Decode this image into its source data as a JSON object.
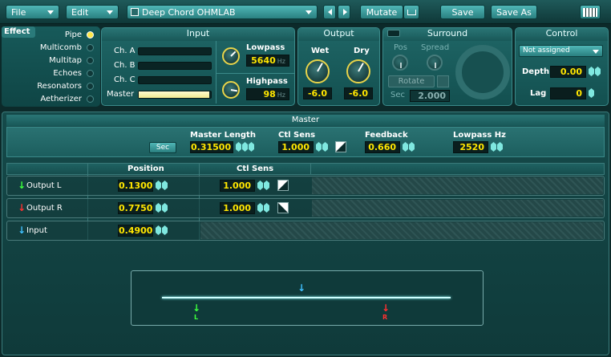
{
  "toolbar": {
    "file": "File",
    "edit": "Edit",
    "preset_name": "Deep Chord OHMLAB",
    "mutate": "Mutate",
    "save": "Save",
    "save_as": "Save As"
  },
  "effect": {
    "tab": "Effect",
    "items": [
      {
        "label": "Pipe",
        "selected": true
      },
      {
        "label": "Multicomb",
        "selected": false
      },
      {
        "label": "Multitap",
        "selected": false
      },
      {
        "label": "Echoes",
        "selected": false
      },
      {
        "label": "Resonators",
        "selected": false
      },
      {
        "label": "Aetherizer",
        "selected": false
      }
    ]
  },
  "input": {
    "title": "Input",
    "ch_a": "Ch. A",
    "ch_b": "Ch. B",
    "ch_c": "Ch. C",
    "master": "Master",
    "master_level": 0.98,
    "lowpass_label": "Lowpass",
    "lowpass_value": "5640",
    "lowpass_unit": "Hz",
    "highpass_label": "Highpass",
    "highpass_value": "98",
    "highpass_unit": "Hz"
  },
  "output": {
    "title": "Output",
    "wet_label": "Wet",
    "wet_value": "-6.0",
    "dry_label": "Dry",
    "dry_value": "-6.0"
  },
  "surround": {
    "title": "Surround",
    "pos_label": "Pos",
    "spread_label": "Spread",
    "rotate": "Rotate",
    "sec_label": "Sec",
    "sec_value": "2.000"
  },
  "control": {
    "title": "Control",
    "assign": "Not assigned",
    "depth_label": "Depth",
    "depth_value": "0.00",
    "lag_label": "Lag",
    "lag_value": "0"
  },
  "master": {
    "title": "Master",
    "sec_button": "Sec",
    "length_label": "Master Length",
    "length_value": "0.31500",
    "ctl_sens_label": "Ctl Sens",
    "ctl_sens_value": "1.000",
    "feedback_label": "Feedback",
    "feedback_value": "0.660",
    "lowpass_label": "Lowpass Hz",
    "lowpass_value": "2520"
  },
  "table": {
    "col_position": "Position",
    "col_ctl_sens": "Ctl Sens",
    "rows": [
      {
        "name": "Output L",
        "arrow": "↓",
        "arrow_color": "#3cff3c",
        "position": "0.1300",
        "ctl_sens": "1.000"
      },
      {
        "name": "Output R",
        "arrow": "↓",
        "arrow_color": "#ff3030",
        "position": "0.7750",
        "ctl_sens": "1.000"
      },
      {
        "name": "Input",
        "arrow": "↓",
        "arrow_color": "#40c0ff",
        "position": "0.4900",
        "ctl_sens": ""
      }
    ]
  },
  "pipe_view": {
    "input_marker": "↓",
    "left_marker": "↓",
    "left_label": "L",
    "right_marker": "↓",
    "right_label": "R"
  }
}
